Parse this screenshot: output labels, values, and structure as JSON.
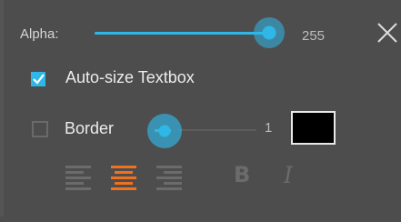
{
  "alpha": {
    "label": "Alpha:",
    "value": "255",
    "level": 1.0
  },
  "autosize": {
    "label": "Auto-size Textbox",
    "checked": true
  },
  "border": {
    "label": "Border",
    "checked": false,
    "value": "1",
    "color": "#000000"
  },
  "style_buttons": {
    "bold_label": "B",
    "italic_label": "I"
  },
  "alignment": {
    "selected": "center"
  },
  "colors": {
    "accent": "#2fb7e8",
    "selected_align": "#f0711e"
  },
  "icons": [
    "close-icon",
    "check-icon",
    "align-left-icon",
    "align-center-icon",
    "align-right-icon"
  ]
}
